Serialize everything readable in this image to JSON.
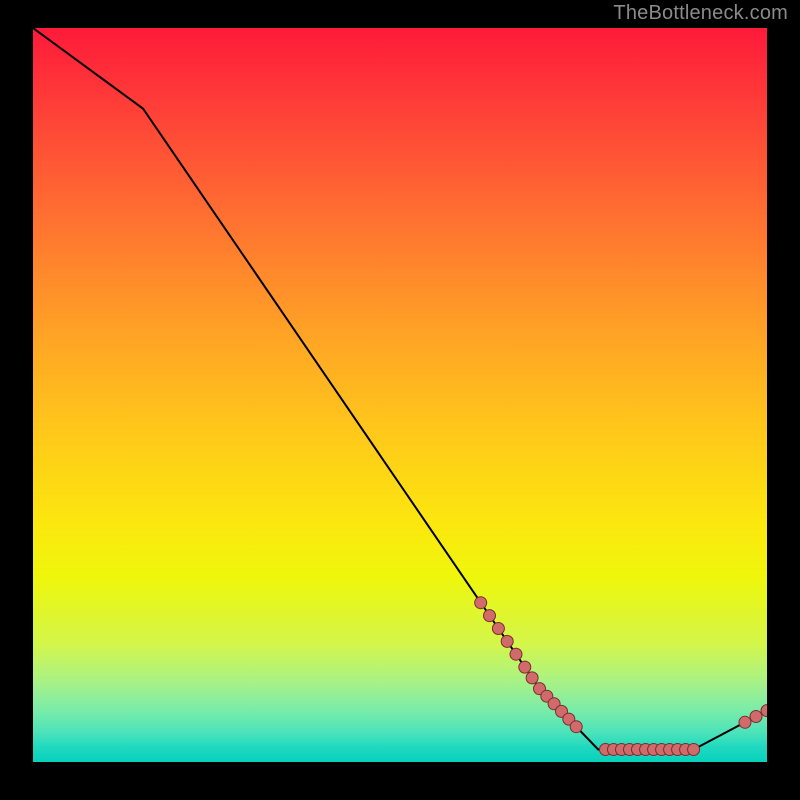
{
  "attribution": "TheBottleneck.com",
  "chart_data": {
    "type": "line",
    "title": "",
    "xlabel": "",
    "ylabel": "",
    "xlim": [
      0,
      100
    ],
    "ylim": [
      0,
      100
    ],
    "x": [
      0,
      15,
      69,
      77,
      90,
      100
    ],
    "y": [
      100,
      89,
      10,
      1.7,
      1.7,
      7
    ],
    "marker_clusters": [
      {
        "x_range": [
          61,
          67
        ],
        "y_approx_range": [
          20,
          13
        ],
        "count": 6
      },
      {
        "x_range": [
          68,
          74
        ],
        "y_approx_range": [
          12,
          4
        ],
        "count": 7
      },
      {
        "x_range": [
          78,
          90
        ],
        "y_approx_range": [
          1.7,
          1.7
        ],
        "count": 12
      },
      {
        "x_range": [
          97,
          100
        ],
        "y_approx_range": [
          5,
          7
        ],
        "count": 3
      }
    ],
    "marker_fill": "#d16a6a",
    "marker_stroke": "#7a2e2e",
    "line_color": "#000000"
  }
}
